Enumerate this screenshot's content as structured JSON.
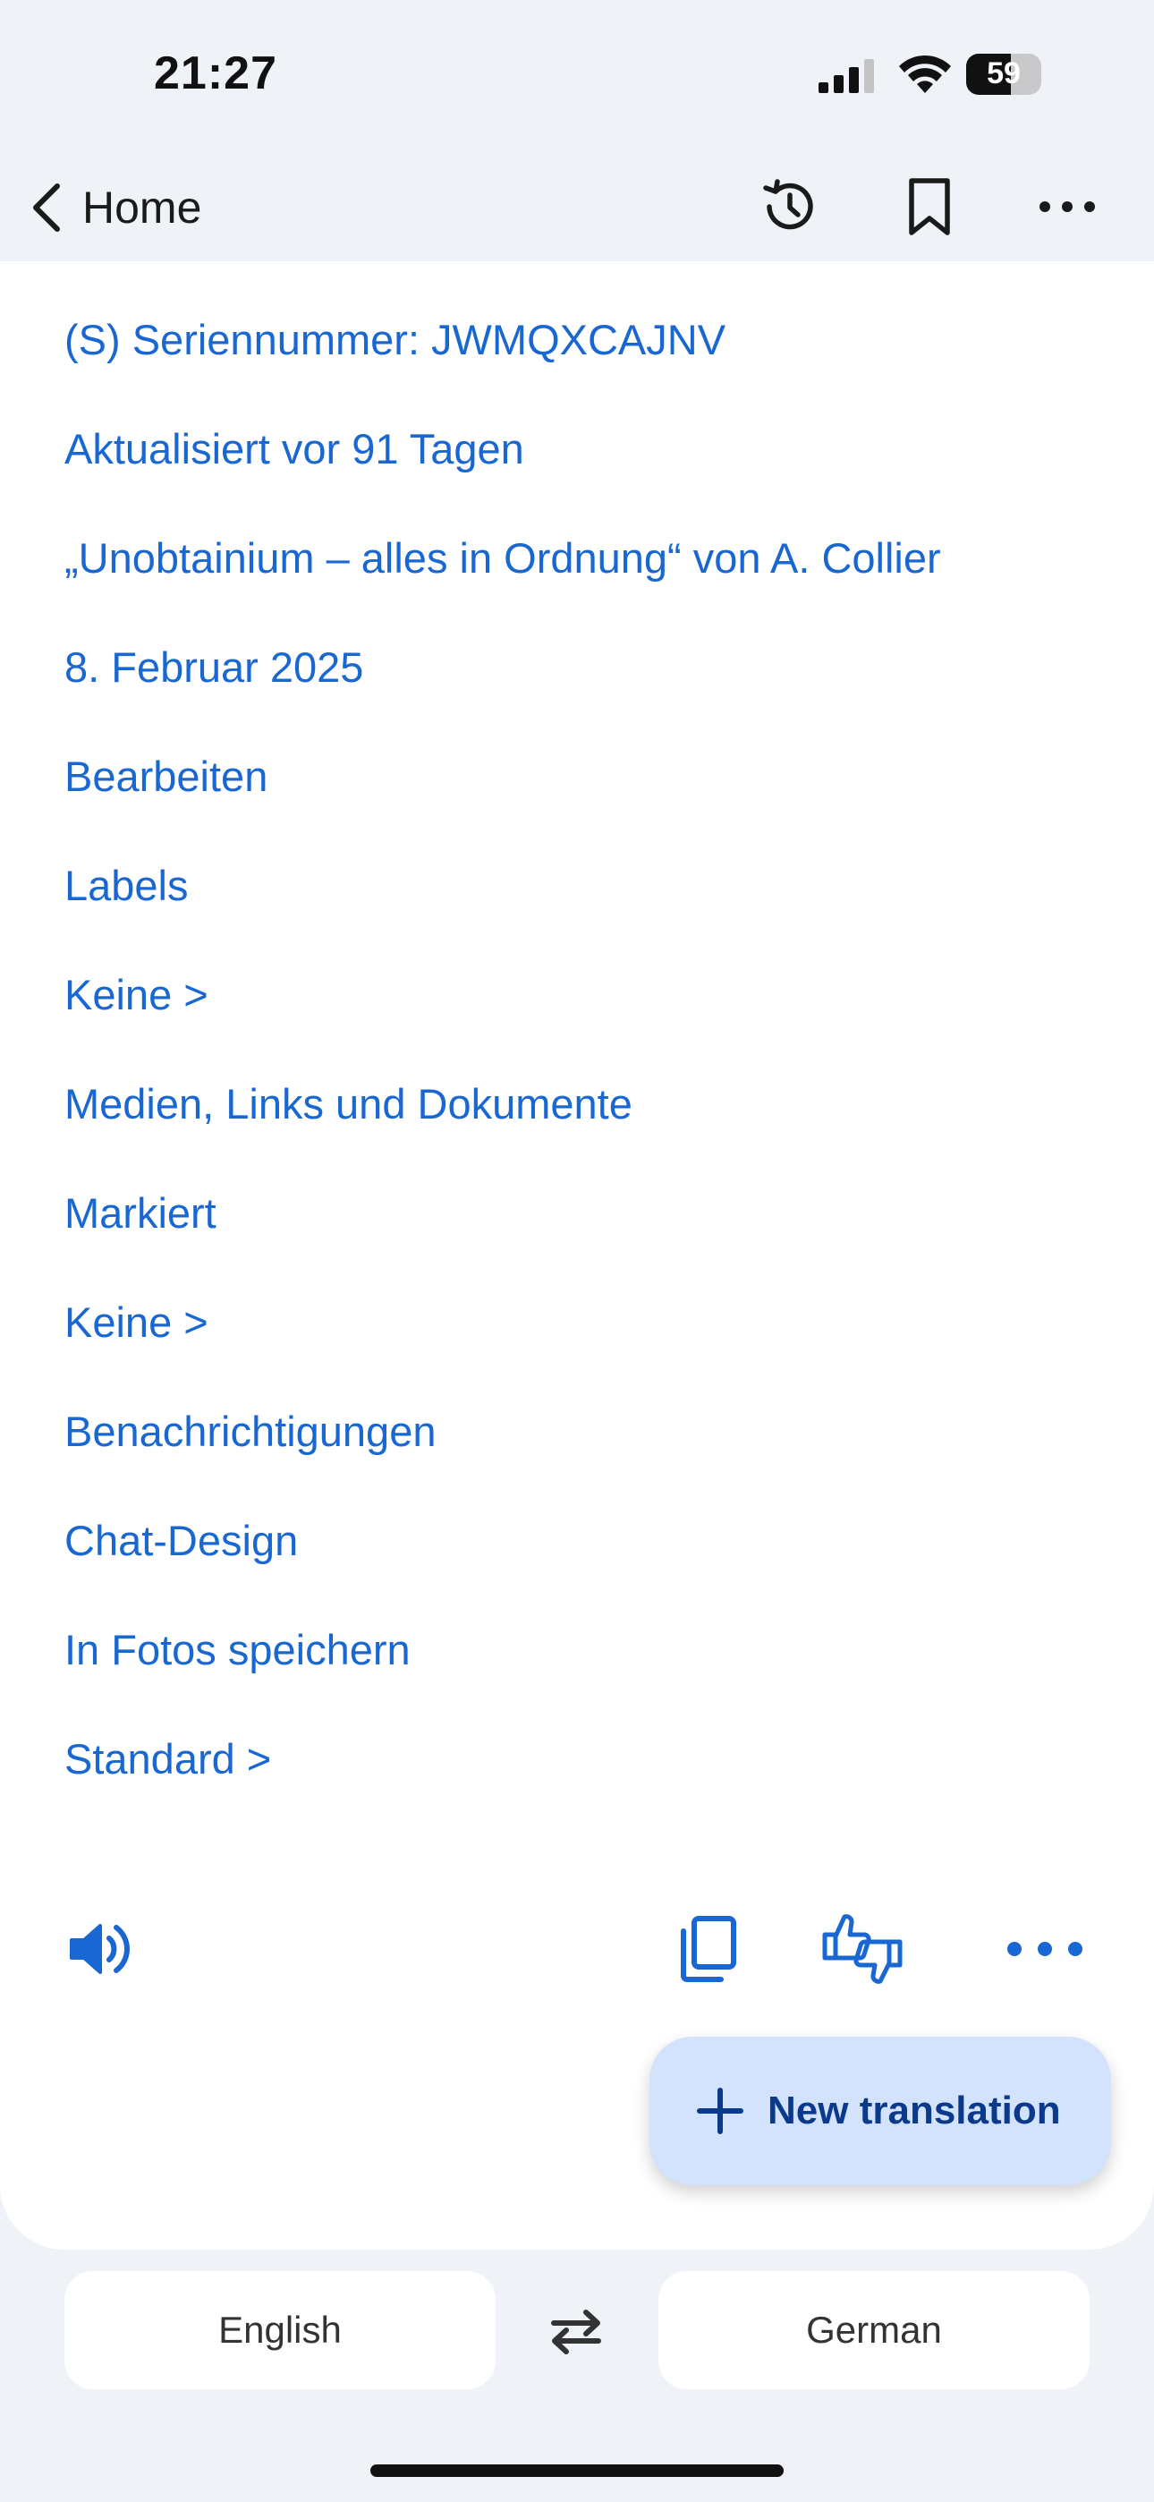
{
  "status_bar": {
    "time": "21:27",
    "battery_level": "59",
    "battery_fraction": 0.59
  },
  "nav": {
    "back_label": "Home",
    "icons": [
      "back-chevron-icon",
      "history-icon",
      "bookmark-icon",
      "more-horizontal-icon"
    ]
  },
  "content": {
    "lines": [
      "(S) Seriennummer: JWMQXCAJNV",
      "Aktualisiert vor 91 Tagen",
      "„Unobtainium – alles in Ordnung“ von A. Collier",
      "8. Februar 2025",
      "Bearbeiten",
      "Labels",
      "Keine >",
      "Medien, Links und Dokumente",
      "Markiert",
      "Keine >",
      "Benachrichtigungen",
      "Chat-Design",
      "In Fotos speichern",
      "Standard >"
    ],
    "text_color": "#1967d2"
  },
  "actions": {
    "icons": [
      "speaker-icon",
      "copy-icon",
      "thumbs-up-down-icon",
      "more-horizontal-icon"
    ],
    "accent_color": "#1967d2"
  },
  "fab": {
    "label": "New translation"
  },
  "language_bar": {
    "source": "English",
    "target": "German"
  }
}
